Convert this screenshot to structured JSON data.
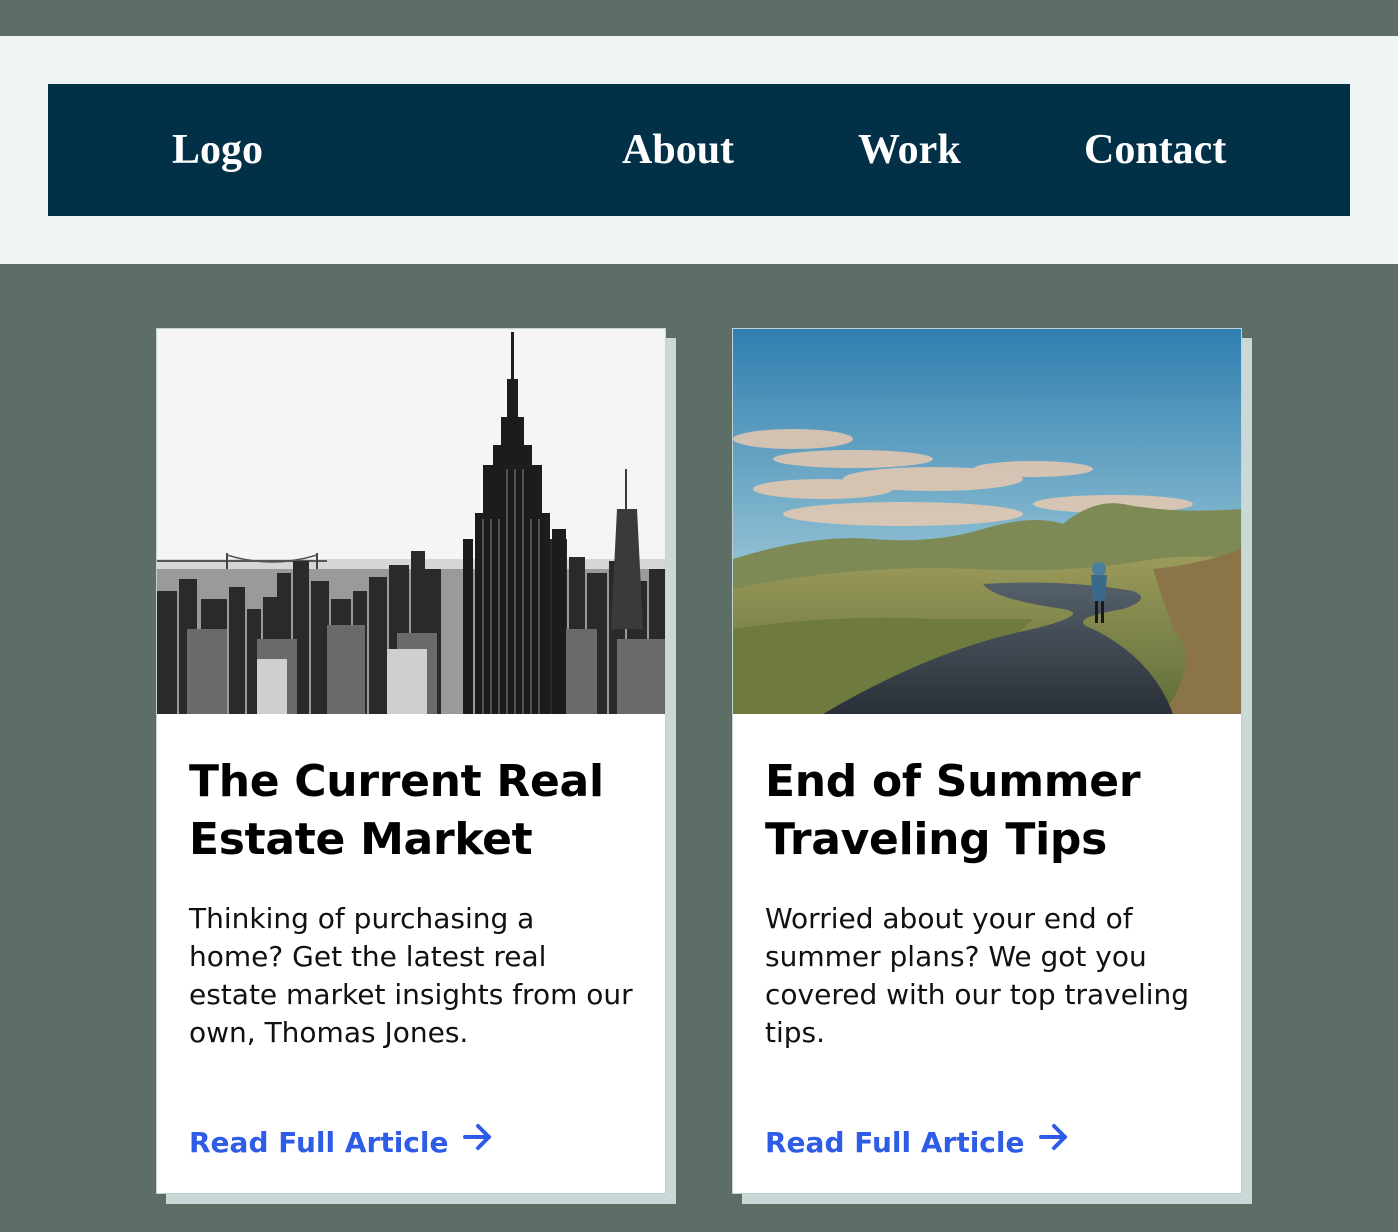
{
  "nav": {
    "logo": "Logo",
    "links": [
      {
        "label": "About"
      },
      {
        "label": "Work"
      },
      {
        "label": "Contact"
      }
    ]
  },
  "cards": [
    {
      "title": "The Current Real Estate Market",
      "body": "Thinking of purchasing a home? Get the latest real estate market insights from our own, Thomas Jones.",
      "link": "Read Full Article",
      "image": "city-skyline-photo",
      "link_icon": "arrow-right-icon"
    },
    {
      "title": "End of Summer Traveling Tips",
      "body": "Worried about your end of summer plans? We got you covered with our top traveling tips.",
      "link": "Read Full Article",
      "image": "mountain-road-cyclist-photo",
      "link_icon": "arrow-right-icon"
    }
  ],
  "colors": {
    "page_background": "#5d6e66",
    "header_band": "#eff5f4",
    "navbar": "#023047",
    "link": "#2e5ce6",
    "card_shadow": "#cbd8d8"
  }
}
